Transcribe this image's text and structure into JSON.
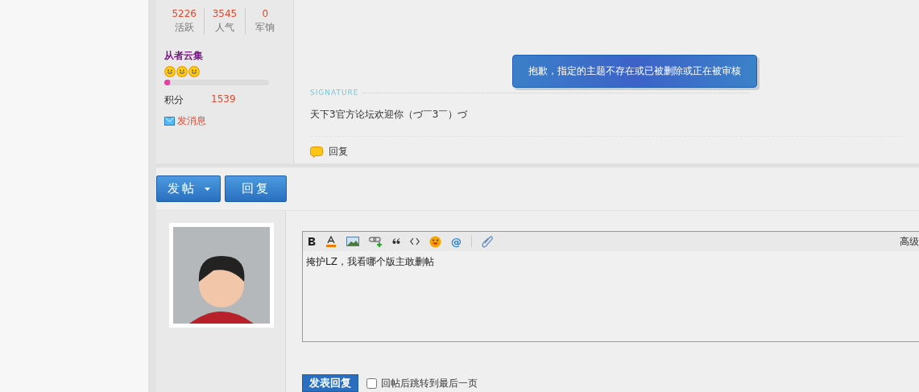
{
  "profile_stats": [
    {
      "value": "5226",
      "label": "活跃"
    },
    {
      "value": "3545",
      "label": "人气"
    },
    {
      "value": "0",
      "label": "军饷"
    }
  ],
  "user": {
    "name": "从者云集",
    "level": 0.05,
    "points_label": "积分",
    "points": "1539",
    "message_link": "发消息"
  },
  "toast": "抱歉，指定的主题不存在或已被删除或正在被审核",
  "signature": {
    "heading": "SIGNATURE",
    "text": "天下3官方论坛欢迎你（づ￣3￣）づ"
  },
  "post_actions": [
    {
      "label": "回复"
    }
  ],
  "buttons": [
    {
      "label": "发帖",
      "dropdown": true
    },
    {
      "label": "回复",
      "dropdown": false
    }
  ],
  "editor": {
    "toolbar": [
      {
        "kind": "bold"
      },
      {
        "kind": "color"
      },
      {
        "kind": "image"
      },
      {
        "kind": "link"
      },
      {
        "kind": "quote"
      },
      {
        "kind": "code"
      },
      {
        "kind": "smiley"
      },
      {
        "kind": "at",
        "text": "@"
      },
      {
        "kind": "sep"
      },
      {
        "kind": "attach"
      }
    ],
    "advanced": "高级",
    "value": "掩护LZ，我看哪个版主敢删帖"
  },
  "submit": {
    "label": "发表回复",
    "option": "回帖后跳转到最后一页",
    "checked": false
  }
}
